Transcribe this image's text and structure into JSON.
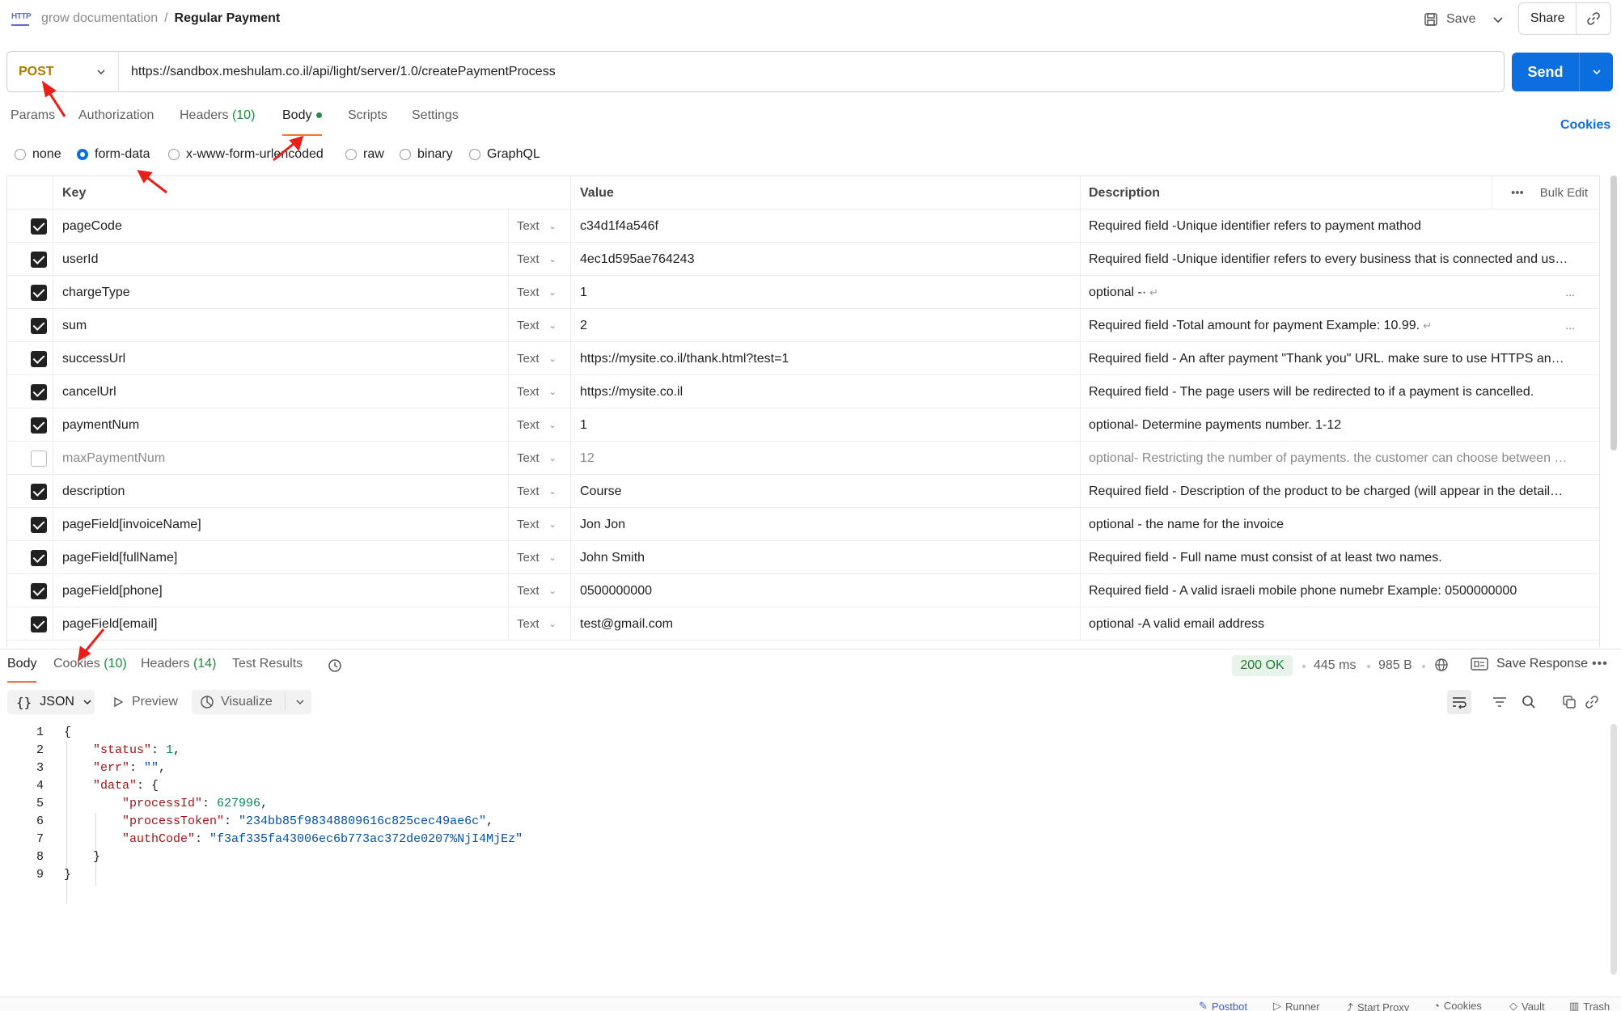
{
  "header": {
    "badge": "HTTP",
    "collection": "grow documentation",
    "separator": "/",
    "request_name": "Regular Payment",
    "save_label": "Save",
    "share_label": "Share"
  },
  "request": {
    "method": "POST",
    "url": "https://sandbox.meshulam.co.il/api/light/server/1.0/createPaymentProcess",
    "send_label": "Send"
  },
  "tabs": {
    "params": "Params",
    "authorization": "Authorization",
    "headers": "Headers",
    "headers_count": "(10)",
    "body": "Body",
    "scripts": "Scripts",
    "settings": "Settings",
    "cookies": "Cookies"
  },
  "body_types": {
    "none": "none",
    "form_data": "form-data",
    "urlencoded": "x-www-form-urlencoded",
    "raw": "raw",
    "binary": "binary",
    "graphql": "GraphQL",
    "selected": "form-data"
  },
  "params_table": {
    "headers": {
      "key": "Key",
      "value": "Value",
      "description": "Description",
      "bulk_edit": "Bulk Edit"
    },
    "rows": [
      {
        "enabled": true,
        "key": "pageCode",
        "type": "Text",
        "value": "c34d1f4a546f",
        "description": "Required field -Unique identifier refers to payment mathod"
      },
      {
        "enabled": true,
        "key": "userId",
        "type": "Text",
        "value": "4ec1d595ae764243",
        "description": "Required field -Unique identifier refers to every business that is connected and use..."
      },
      {
        "enabled": true,
        "key": "chargeType",
        "type": "Text",
        "value": "1",
        "description": "optional -·"
      },
      {
        "enabled": true,
        "key": "sum",
        "type": "Text",
        "value": "2",
        "description": "Required field -Total amount for payment Example: 10.99."
      },
      {
        "enabled": true,
        "key": "successUrl",
        "type": "Text",
        "value": "https://mysite.co.il/thank.html?test=1",
        "description": "Required field - An after payment \"Thank you\" URL. make sure to use HTTPS and n..."
      },
      {
        "enabled": true,
        "key": "cancelUrl",
        "type": "Text",
        "value": "https://mysite.co.il",
        "description": "Required field - The page users will be redirected to if a payment is cancelled."
      },
      {
        "enabled": true,
        "key": "paymentNum",
        "type": "Text",
        "value": "1",
        "description": "optional- Determine payments number. 1-12"
      },
      {
        "enabled": false,
        "key": "maxPaymentNum",
        "type": "Text",
        "value": "12",
        "description": "optional- Restricting the number of payments. the customer can choose between 1..."
      },
      {
        "enabled": true,
        "key": "description",
        "type": "Text",
        "value": "Course",
        "description": "Required field - Description of the product to be charged (will appear in the details ..."
      },
      {
        "enabled": true,
        "key": "pageField[invoiceName]",
        "type": "Text",
        "value": "Jon Jon",
        "description": "optional - the name for the invoice"
      },
      {
        "enabled": true,
        "key": "pageField[fullName]",
        "type": "Text",
        "value": "John Smith",
        "description": "Required field - Full name must consist of at least two names."
      },
      {
        "enabled": true,
        "key": "pageField[phone]",
        "type": "Text",
        "value": "0500000000",
        "description": "Required field - A valid israeli mobile phone numebr Example: 0500000000"
      },
      {
        "enabled": true,
        "key": "pageField[email]",
        "type": "Text",
        "value": "test@gmail.com",
        "description": "optional -A valid email address"
      }
    ]
  },
  "response": {
    "tabs": {
      "body": "Body",
      "cookies": "Cookies",
      "cookies_count": "(10)",
      "headers": "Headers",
      "headers_count": "(14)",
      "test_results": "Test Results"
    },
    "status": "200 OK",
    "time": "445 ms",
    "size": "985 B",
    "save_response": "Save Response",
    "format": "JSON",
    "preview": "Preview",
    "visualize": "Visualize",
    "line_numbers": [
      "1",
      "2",
      "3",
      "4",
      "5",
      "6",
      "7",
      "8",
      "9"
    ],
    "json": {
      "status_key": "\"status\"",
      "status_val": "1",
      "err_key": "\"err\"",
      "err_val": "\"\"",
      "data_key": "\"data\"",
      "processId_key": "\"processId\"",
      "processId_val": "627996",
      "processToken_key": "\"processToken\"",
      "processToken_val": "\"234bb85f98348809616c825cec49ae6c\"",
      "authCode_key": "\"authCode\"",
      "authCode_val": "\"f3af335fa43006ec6b773ac372de0207%NjI4MjEz\""
    }
  },
  "statusbar": {
    "postbot": "Postbot",
    "runner": "Runner",
    "proxy": "Start Proxy",
    "cookies": "Cookies",
    "vault": "Vault",
    "trash": "Trash"
  },
  "colors": {
    "accent": "#0c6fe0",
    "method": "#ad7a03",
    "active_tab": "#ff6c37",
    "status_ok": "#1e7a34",
    "annotation": "#e8201b"
  }
}
